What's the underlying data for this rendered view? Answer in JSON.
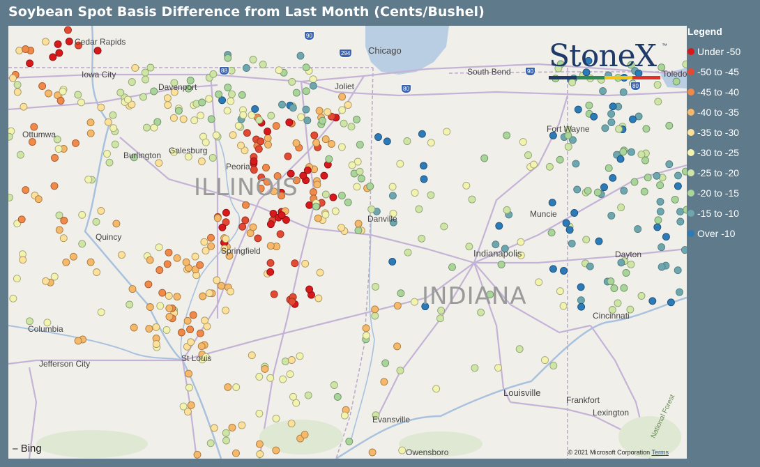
{
  "title": "Soybean Spot Basis Difference from Last Month (Cents/Bushel)",
  "legend": {
    "title": "Legend",
    "items": [
      {
        "label": "Under -50",
        "color": "#d7191c"
      },
      {
        "label": "-50 to -45",
        "color": "#e34a33"
      },
      {
        "label": "-45 to -40",
        "color": "#f08a4b"
      },
      {
        "label": "-40 to -35",
        "color": "#f6b86b"
      },
      {
        "label": "-35 to -30",
        "color": "#fde09a"
      },
      {
        "label": "-30 to -25",
        "color": "#f3f3b0"
      },
      {
        "label": "-25 to -20",
        "color": "#cfe5a6"
      },
      {
        "label": "-20 to -15",
        "color": "#a9d49a"
      },
      {
        "label": "-15 to -10",
        "color": "#6fa6ad"
      },
      {
        "label": "Over -10",
        "color": "#2c7bb6"
      }
    ]
  },
  "logo": {
    "text": "StoneX",
    "tm": "™",
    "bar_colors": [
      "#1f3a66",
      "#2e8b57",
      "#f0c419",
      "#e0302a"
    ]
  },
  "map": {
    "states": [
      "ILLINOIS",
      "INDIANA"
    ],
    "cities": [
      "Cedar Rapids",
      "Iowa City",
      "Davenport",
      "Chicago",
      "South Bend",
      "Joliet",
      "Toledo",
      "Ottumwa",
      "Burlington",
      "Galesburg",
      "Peoria",
      "Fort Wayne",
      "Muncie",
      "Danville",
      "Quincy",
      "Springfield",
      "Indianapolis",
      "Dayton",
      "Columbia",
      "Jefferson City",
      "St Louis",
      "Cincinnati",
      "Louisville",
      "Frankfort",
      "Lexington",
      "Evansville",
      "Owensboro"
    ],
    "highways": [
      "90",
      "294",
      "88",
      "80",
      "90",
      "80"
    ],
    "attribution": "Bing",
    "copyright": "© 2021 Microsoft Corporation",
    "terms": "Terms",
    "forest_label": "National Forest"
  }
}
